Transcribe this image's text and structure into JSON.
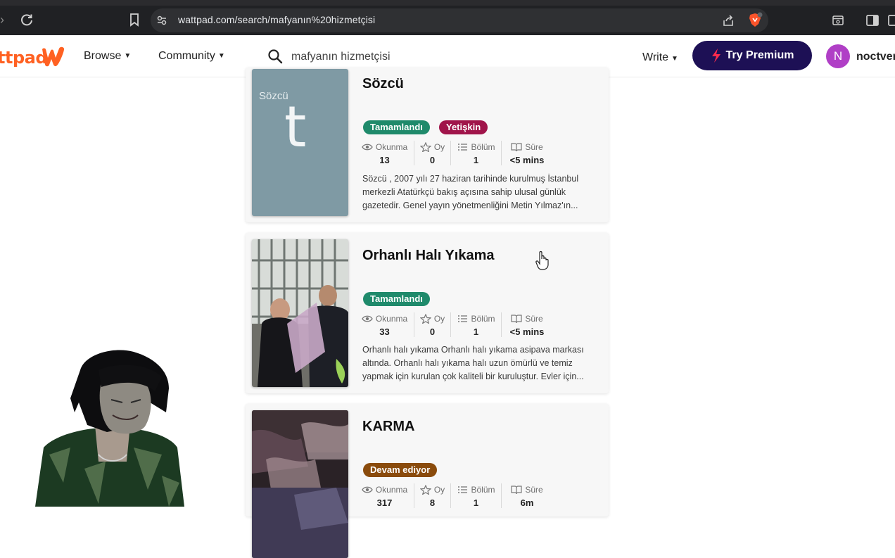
{
  "browser": {
    "url": "wattpad.com/search/mafyanın%20hizmetçisi"
  },
  "header": {
    "logo_text": "ttpad",
    "nav": [
      {
        "label": "Browse"
      },
      {
        "label": "Community"
      }
    ],
    "search_value": "mafyanın hizmetçisi",
    "write_label": "Write",
    "premium_label": "Try Premium",
    "avatar_letter": "N",
    "username": "noctver"
  },
  "stat_labels": {
    "reads": "Okunma",
    "votes": "Oy",
    "parts": "Bölüm",
    "time": "Süre"
  },
  "stories": [
    {
      "title": "Sözcü",
      "cover_text": "Sözcü",
      "cover_letter": "t",
      "badges": [
        "Tamamlandı",
        "Yetişkin"
      ],
      "reads": "13",
      "votes": "0",
      "parts": "1",
      "time": "<5 mins",
      "description": "Sözcü , 2007 yılı 27 haziran tarihinde kurulmuş İstanbul merkezli Atatürkçü bakış açısına sahip ulusal günlük gazetedir. Genel yayın yönetmenliğini Metin Yılmaz'ın..."
    },
    {
      "title": "Orhanlı Halı Yıkama",
      "badges": [
        "Tamamlandı"
      ],
      "reads": "33",
      "votes": "0",
      "parts": "1",
      "time": "<5 mins",
      "description": "Orhanlı halı yıkama Orhanlı halı yıkama asipava markası altında. Orhanlı halı yıkama halı uzun ömürlü ve temiz yapmak için kurulan çok kaliteli bir kuruluştur. Evler için..."
    },
    {
      "title": "KARMA",
      "badges": [
        "Devam ediyor"
      ],
      "reads": "317",
      "votes": "8",
      "parts": "1",
      "time": "6m"
    }
  ],
  "colors": {
    "brand_orange": "#ff6122",
    "premium_bg": "#1d1055",
    "badge_complete": "#1f8a6b",
    "badge_mature": "#a0144a",
    "badge_ongoing": "#8a4b0c"
  }
}
